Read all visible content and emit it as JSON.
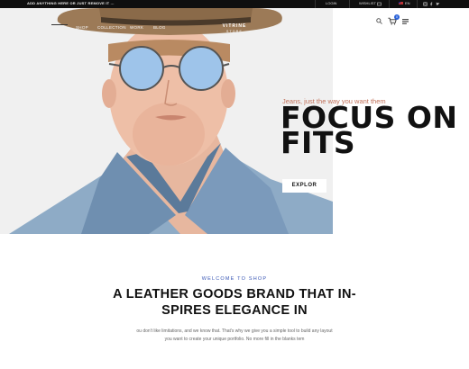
{
  "topbar": {
    "message": "ADD ANYTHING HERE OR JUST REMOVE IT ...",
    "login_label": "LOGIN",
    "wishlist_label": "WISHLIST",
    "language_label": "EN"
  },
  "nav": {
    "items": [
      "SHOP",
      "COLLECTION",
      "WORK",
      "BLOG"
    ],
    "logo_main": "VITRINE",
    "logo_sub": "STORE",
    "cart_count": "0"
  },
  "hero": {
    "tagline": "Jeans, just the way you want them",
    "headline_line1": "FOCUS ON",
    "headline_line2": "FITS",
    "cta_label": "EXPLOR"
  },
  "intro": {
    "eyebrow": "WELCOME TO SHOP",
    "title_line1": "A LEATHER GOODS BRAND THAT IN-",
    "title_line2": "SPIRES ELEGANCE IN",
    "body_line1": "ou don't like limitations, and we know that. That's why we give you a simple tool to build any layout",
    "body_line2": "you want to create your unique portfolio. No more fill in the blanks tem"
  },
  "colors": {
    "accent": "#2b63d9",
    "tagline": "#c0715a",
    "topbar": "#0f0f0f",
    "hero_bg": "#f0f0f0"
  },
  "icons": [
    "user-icon",
    "heart-icon",
    "menu-icon",
    "flag-icon",
    "instagram-icon",
    "facebook-icon",
    "twitter-icon",
    "search-icon",
    "cart-icon",
    "hamburger-icon"
  ]
}
